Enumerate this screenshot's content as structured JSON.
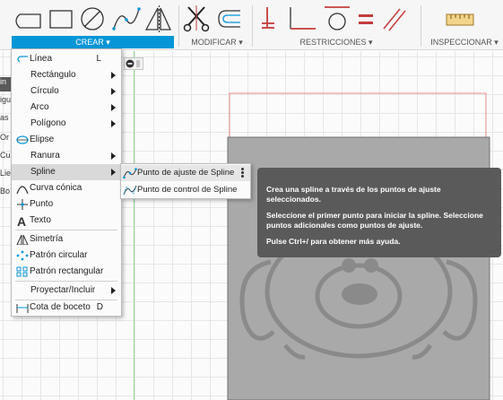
{
  "toolbar": {
    "groups": {
      "crear": "CREAR ▾",
      "modificar": "MODIFICAR ▾",
      "restricciones": "RESTRICCIONES ▾",
      "inspeccionar": "INSPECCIONAR ▾"
    },
    "accent_color": "#0696d7"
  },
  "browser_fragments": [
    "in",
    "igu",
    "as c",
    "Or",
    "Cu",
    "Lie",
    "Bo"
  ],
  "menu": {
    "items": [
      {
        "label": "Línea",
        "shortcut": "L",
        "icon": "line-icon"
      },
      {
        "label": "Rectángulo",
        "icon": "none"
      },
      {
        "label": "Círculo",
        "icon": "none"
      },
      {
        "label": "Arco",
        "icon": "none"
      },
      {
        "label": "Polígono",
        "icon": "none"
      },
      {
        "label": "Elipse",
        "icon": "ellipse-icon"
      },
      {
        "label": "Ranura",
        "icon": "none"
      },
      {
        "label": "Spline",
        "icon": "none"
      },
      {
        "label": "Curva cónica",
        "icon": "conic-curve-icon"
      },
      {
        "label": "Punto",
        "icon": "point-icon"
      },
      {
        "label": "Texto",
        "icon": "text-icon"
      },
      {
        "label": "Simetría",
        "icon": "mirror-icon"
      },
      {
        "label": "Patrón circular",
        "icon": "circular-pattern-icon"
      },
      {
        "label": "Patrón rectangular",
        "icon": "rectangular-pattern-icon"
      },
      {
        "label": "Proyectar/Incluir",
        "icon": "none"
      },
      {
        "label": "Cota de boceto",
        "shortcut": "D",
        "icon": "sketch-dimension-icon"
      }
    ]
  },
  "submenu": {
    "items": [
      {
        "label": "Punto de ajuste de Spline",
        "icon": "fit-point-spline-icon"
      },
      {
        "label": "Punto de control de Spline",
        "icon": "control-point-spline-icon"
      }
    ]
  },
  "tooltip": {
    "line1": "Crea una spline a través de los puntos de ajuste seleccionados.",
    "line2": "Seleccione el primer punto para iniciar la spline. Seleccione puntos adicionales como puntos de ajuste.",
    "line3": "Pulse Ctrl+/ para obtener más ayuda."
  }
}
